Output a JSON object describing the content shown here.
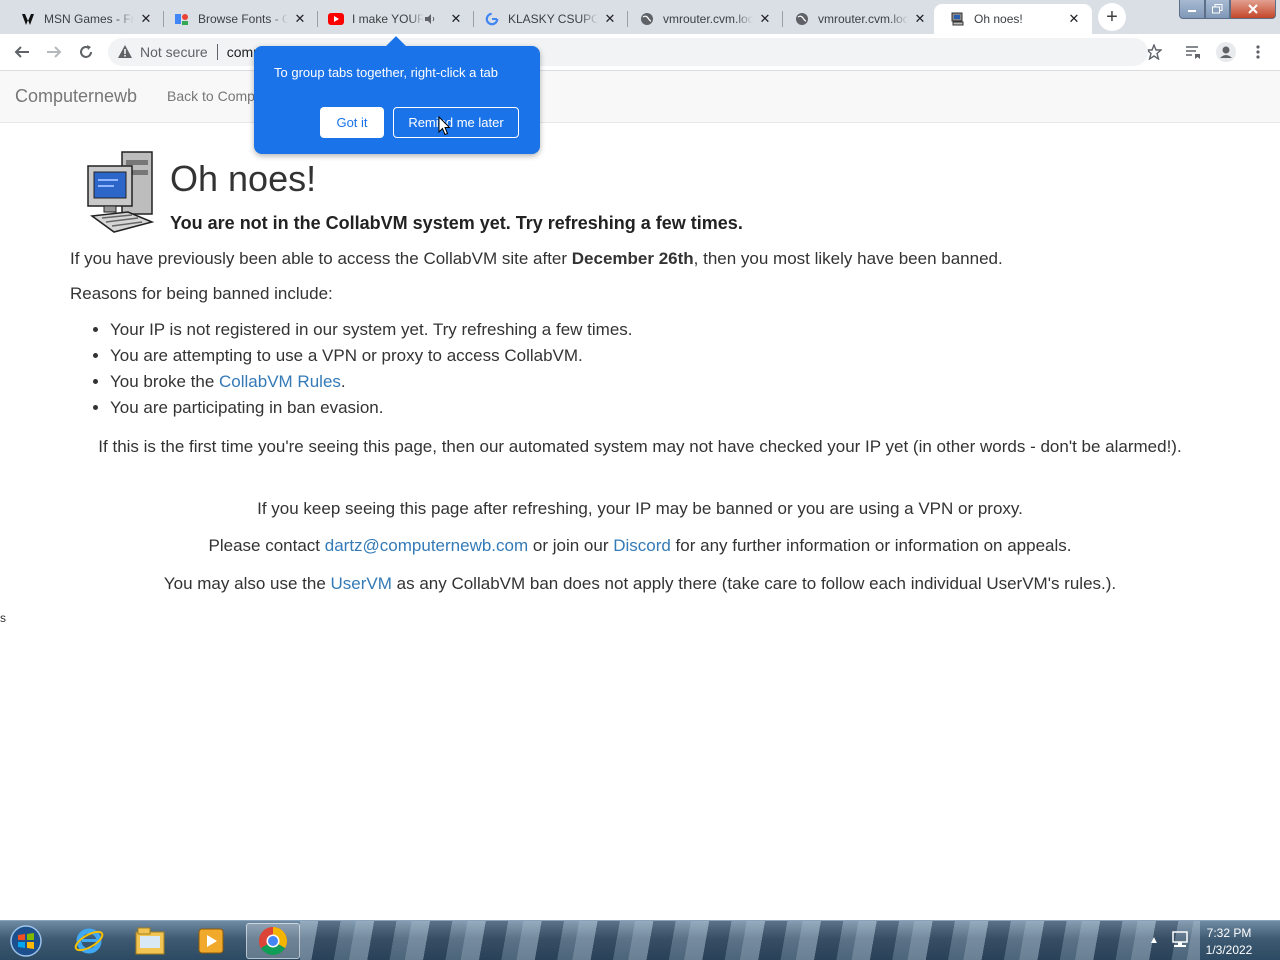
{
  "browser": {
    "tabs": [
      {
        "title": "MSN Games - Free",
        "favicon": "msn-icon"
      },
      {
        "title": "Browse Fonts - Goo",
        "favicon": "google-fonts-icon"
      },
      {
        "title": "I make YOUR",
        "favicon": "youtube-icon",
        "audio": true
      },
      {
        "title": "KLASKY CSUPO",
        "favicon": "google-icon"
      },
      {
        "title": "vmrouter.cvm.local",
        "favicon": "globe-icon"
      },
      {
        "title": "vmrouter.cvm.local",
        "favicon": "globe-icon"
      },
      {
        "title": "Oh noes!",
        "favicon": "computer-icon",
        "active": true
      }
    ],
    "security_label": "Not secure",
    "url": "computernewb.com/collab-vm/"
  },
  "tab_groups_tip": {
    "text": "To group tabs together, right-click a tab",
    "got_it": "Got it",
    "remind_later": "Remind me later"
  },
  "navbar": {
    "brand": "Computernewb",
    "back_link": "Back to Computernewb"
  },
  "page": {
    "heading": "Oh noes!",
    "lead": "You are not in the CollabVM system yet. Try refreshing a few times.",
    "p1_before": "If you have previously been able to access the CollabVM site after ",
    "p1_bold": "December 26th",
    "p1_after": ", then you most likely have been banned.",
    "reasons_intro": "Reasons for being banned include:",
    "reason1": "Your IP is not registered in our system yet. Try refreshing a few times.",
    "reason2": "You are attempting to use a VPN or proxy to access CollabVM.",
    "reason3_before": "You broke the ",
    "reason3_link": "CollabVM Rules",
    "reason3_after": ".",
    "reason4": "You are participating in ban evasion.",
    "p_first_time": "If this is the first time you're seeing this page, then our automated system may not have checked your IP yet (in other words - don't be alarmed!).",
    "p_keep": "If you keep seeing this page after refreshing, your IP may be banned or you are using a VPN or proxy.",
    "contact_before": "Please contact ",
    "contact_email": "dartz@computernewb.com",
    "contact_mid": " or join our ",
    "contact_discord": "Discord",
    "contact_after": " for any further information or information on appeals.",
    "uservm_before": "You may also use the ",
    "uservm_link": "UserVM",
    "uservm_after": " as any CollabVM ban does not apply there (take care to follow each individual UserVM's rules.).",
    "stray": "s"
  },
  "taskbar": {
    "time": "7:32 PM",
    "date": "1/3/2022",
    "apps": [
      "internet-explorer-icon",
      "file-explorer-icon",
      "media-player-icon",
      "chrome-icon"
    ]
  },
  "colors": {
    "link": "#337ab7",
    "tip_background": "#1a73e8",
    "navbar_background": "#f8f8f8"
  }
}
